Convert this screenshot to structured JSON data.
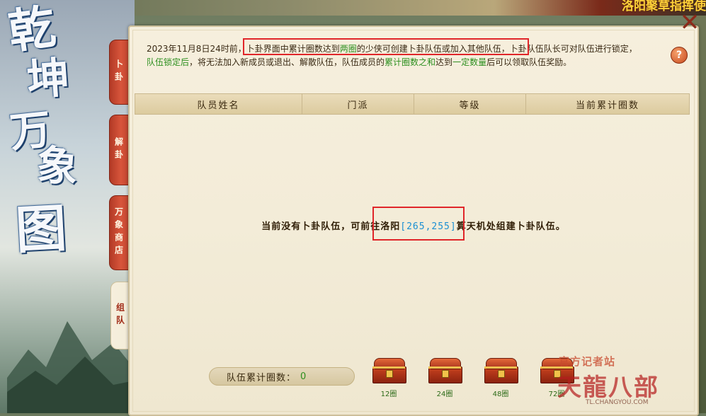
{
  "top_right_banner": "洛阳聚草指挥使",
  "title_calligraphy": [
    "乾",
    "坤",
    "万",
    "象",
    "图"
  ],
  "tabs": [
    {
      "label": "卜卦"
    },
    {
      "label": "解卦"
    },
    {
      "label": "万象商店"
    },
    {
      "label": "组队"
    }
  ],
  "notice": {
    "date_prefix": "2023年11月8日24时前，",
    "highlight_part1": "卜卦界面中累计圈数达到",
    "highlight_rounds": "两圈",
    "highlight_part2": "的少侠可创建卜卦队伍或加入其他队伍",
    "rest_line1": "，卜卦队伍队长可对队伍进行锁定，",
    "lock_label": "队伍锁定后",
    "rest_line2": "，将无法加入新成员或退出、解散队伍，队伍成员的",
    "cumulative_label": "累计圈数之和",
    "rest_line3": "达到",
    "certain_amount": "一定数量",
    "rest_line4": "后可以领取队伍奖励。"
  },
  "help_icon_text": "?",
  "table": {
    "columns": [
      "队员姓名",
      "门派",
      "等级",
      "当前累计圈数"
    ]
  },
  "empty_message": {
    "before": "当前没有卜卦队伍，可前往洛阳",
    "coords": "[265,255]",
    "after": "算天机处组建卜卦队伍。"
  },
  "team_total": {
    "label": "队伍累计圈数：",
    "value": "0"
  },
  "reward_chests": [
    {
      "label": "12圈"
    },
    {
      "label": "24圈"
    },
    {
      "label": "48圈"
    },
    {
      "label": "72圈"
    }
  ],
  "watermark": {
    "top": "官方记者站",
    "main": "天龍八部",
    "url": "TL.CHANGYOU.COM"
  },
  "colors": {
    "accent_red": "#e0262a",
    "link_blue": "#1b8fd3",
    "green_text": "#2d8f1f"
  }
}
